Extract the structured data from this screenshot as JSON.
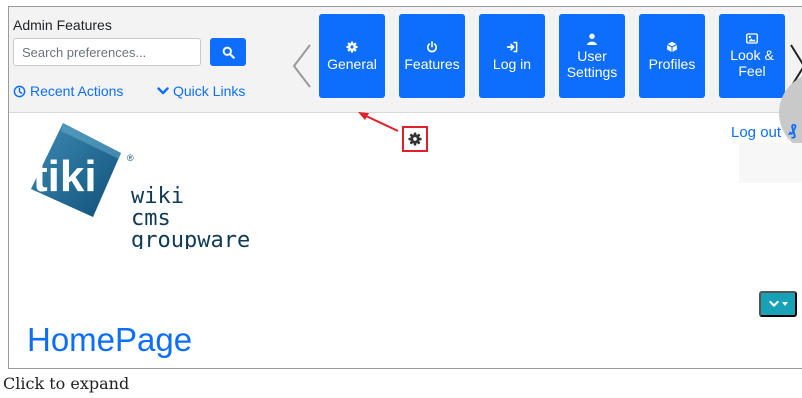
{
  "admin": {
    "title": "Admin Features",
    "search_placeholder": "Search preferences...",
    "recent_actions": "Recent Actions",
    "quick_links": "Quick Links"
  },
  "features": [
    {
      "label": "General",
      "icon": "gear-icon"
    },
    {
      "label": "Features",
      "icon": "power-icon"
    },
    {
      "label": "Log in",
      "icon": "sign-in-icon"
    },
    {
      "label": "User\nSettings",
      "icon": "user-icon"
    },
    {
      "label": "Profiles",
      "icon": "cube-icon"
    },
    {
      "label": "Look &\nFeel",
      "icon": "image-icon"
    }
  ],
  "header": {
    "logout": "Log out",
    "logout_icon": "sign-out-icon"
  },
  "logo": {
    "brand": "tiki",
    "line1": "wiki",
    "line2": "cms",
    "line3": "groupware"
  },
  "page": {
    "title": "HomePage"
  },
  "caption": "Click to expand",
  "colors": {
    "primary": "#0d6efd",
    "teal": "#17a2b8",
    "highlight": "#e0202a",
    "topbar_bg": "#f3f3f3"
  }
}
